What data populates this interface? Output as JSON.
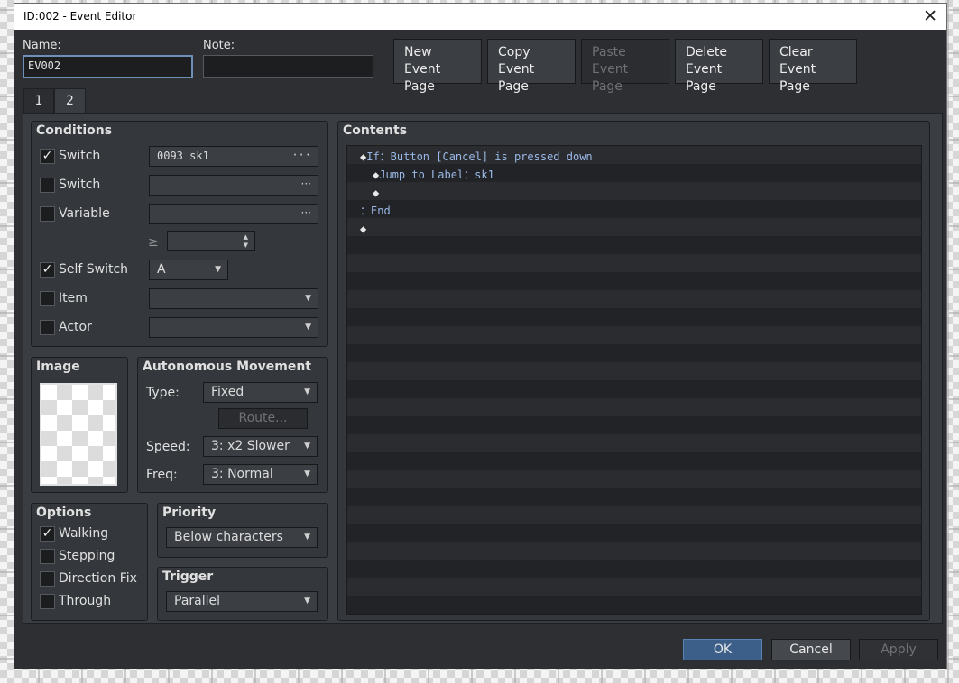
{
  "window": {
    "title": "ID:002 - Event Editor"
  },
  "form": {
    "name_label": "Name:",
    "name_value": "EV002",
    "note_label": "Note:",
    "note_value": ""
  },
  "page_buttons": [
    {
      "line1": "New",
      "line2": "Event Page"
    },
    {
      "line1": "Copy",
      "line2": "Event Page"
    },
    {
      "line1": "Paste",
      "line2": "Event Page"
    },
    {
      "line1": "Delete",
      "line2": "Event Page"
    },
    {
      "line1": "Clear",
      "line2": "Event Page"
    }
  ],
  "tabs": [
    "1",
    "2"
  ],
  "conditions": {
    "title": "Conditions",
    "switch1": {
      "label": "Switch",
      "checked": true,
      "value": "0093 sk1"
    },
    "switch2": {
      "label": "Switch",
      "checked": false,
      "value": ""
    },
    "variable": {
      "label": "Variable",
      "checked": false,
      "value": "",
      "op": "≥",
      "num": ""
    },
    "self_switch": {
      "label": "Self Switch",
      "checked": true,
      "value": "A"
    },
    "item": {
      "label": "Item",
      "checked": false,
      "value": ""
    },
    "actor": {
      "label": "Actor",
      "checked": false,
      "value": ""
    }
  },
  "image": {
    "title": "Image"
  },
  "movement": {
    "title": "Autonomous Movement",
    "type_label": "Type:",
    "type_value": "Fixed",
    "route_label": "Route...",
    "speed_label": "Speed:",
    "speed_value": "3: x2 Slower",
    "freq_label": "Freq:",
    "freq_value": "3: Normal"
  },
  "options": {
    "title": "Options",
    "items": [
      {
        "label": "Walking",
        "checked": true
      },
      {
        "label": "Stepping",
        "checked": false
      },
      {
        "label": "Direction Fix",
        "checked": false
      },
      {
        "label": "Through",
        "checked": false
      }
    ]
  },
  "priority": {
    "title": "Priority",
    "value": "Below characters"
  },
  "trigger": {
    "title": "Trigger",
    "value": "Parallel"
  },
  "contents": {
    "title": "Contents",
    "lines": [
      {
        "diamond": true,
        "text": "If：Button [Cancel] is pressed down"
      },
      {
        "diamond": true,
        "text": "Jump to Label：sk1"
      },
      {
        "diamond": true,
        "text": ""
      },
      {
        "diamond": false,
        "text": "：End"
      },
      {
        "diamond": true,
        "text": ""
      }
    ]
  },
  "footer": {
    "ok": "OK",
    "cancel": "Cancel",
    "apply": "Apply"
  }
}
